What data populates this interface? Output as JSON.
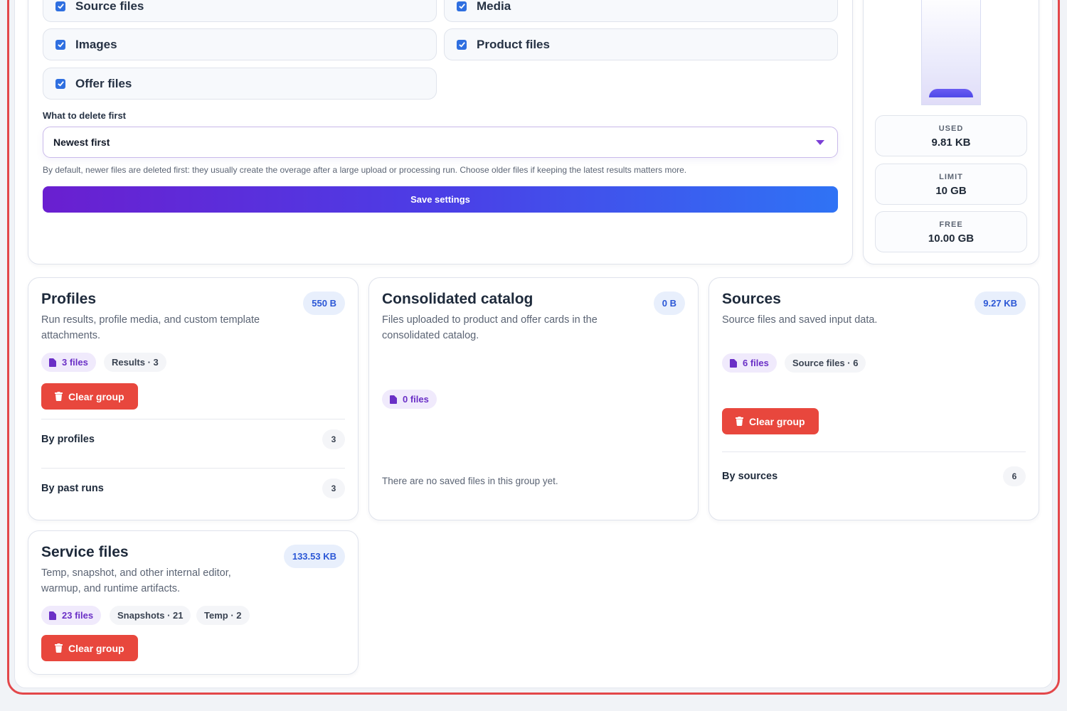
{
  "settings": {
    "types": [
      {
        "label": "Source files",
        "checked": true
      },
      {
        "label": "Media",
        "checked": true
      },
      {
        "label": "Images",
        "checked": true
      },
      {
        "label": "Product files",
        "checked": true
      },
      {
        "label": "Offer files",
        "checked": true
      }
    ],
    "order_label": "What to delete first",
    "order_value": "Newest first",
    "hint": "By default, newer files are deleted first: they usually create the overage after a large upload or processing run. Choose older files if keeping the latest results matters more.",
    "save_label": "Save settings"
  },
  "usage": {
    "used_label": "USED",
    "used_value": "9.81 KB",
    "limit_label": "LIMIT",
    "limit_value": "10 GB",
    "free_label": "FREE",
    "free_value": "10.00 GB",
    "fill_fraction": 0.001
  },
  "groups": {
    "profiles": {
      "title": "Profiles",
      "desc": "Run results, profile media, and custom template attachments.",
      "size": "550 B",
      "files": "3 files",
      "chips": [
        "Results · 3"
      ],
      "clear_label": "Clear group",
      "rows": [
        {
          "label": "By profiles",
          "count": "3"
        },
        {
          "label": "By past runs",
          "count": "3"
        }
      ]
    },
    "catalog": {
      "title": "Consolidated catalog",
      "desc": "Files uploaded to product and offer cards in the consolidated catalog.",
      "size": "0 B",
      "files": "0 files",
      "empty": "There are no saved files in this group yet."
    },
    "sources": {
      "title": "Sources",
      "desc": "Source files and saved input data.",
      "size": "9.27 KB",
      "files": "6 files",
      "chips": [
        "Source files · 6"
      ],
      "clear_label": "Clear group",
      "rows": [
        {
          "label": "By sources",
          "count": "6"
        }
      ]
    },
    "service": {
      "title": "Service files",
      "desc": "Temp, snapshot, and other internal editor, warmup, and runtime artifacts.",
      "size": "133.53 KB",
      "files": "23 files",
      "chips": [
        "Snapshots · 21",
        "Temp · 2"
      ],
      "clear_label": "Clear group"
    }
  },
  "colors": {
    "accent_purple": "#6a1fd0",
    "accent_blue": "#2f73f5",
    "danger": "#e8473d",
    "frame_border": "#e3474a"
  }
}
